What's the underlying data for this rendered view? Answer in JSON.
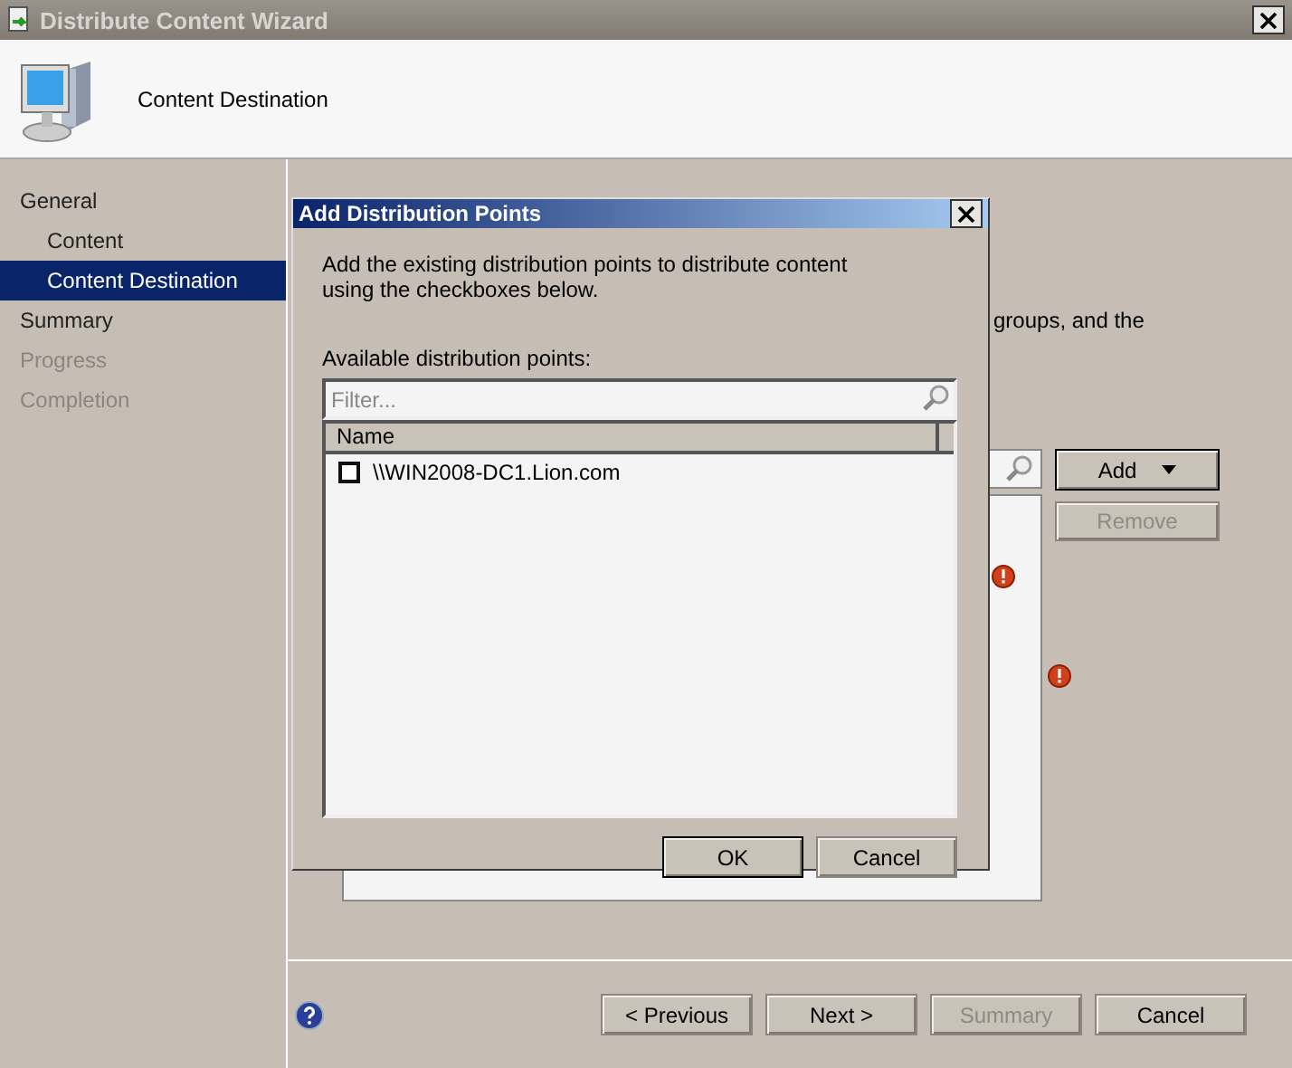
{
  "window": {
    "title": "Distribute Content Wizard"
  },
  "header": {
    "title": "Content Destination"
  },
  "nav": [
    {
      "label": "General",
      "selected": false,
      "disabled": false,
      "children": [
        {
          "label": "Content",
          "selected": false,
          "disabled": false
        },
        {
          "label": "Content Destination",
          "selected": true,
          "disabled": false
        }
      ]
    },
    {
      "label": "Summary",
      "selected": false,
      "disabled": false
    },
    {
      "label": "Progress",
      "selected": false,
      "disabled": true
    },
    {
      "label": "Completion",
      "selected": false,
      "disabled": true
    }
  ],
  "page": {
    "partial_text": "groups, and the",
    "add_button": "Add",
    "remove_button": {
      "label": "Remove",
      "disabled": true
    }
  },
  "footer": {
    "buttons": [
      {
        "label": "< Previous",
        "disabled": false
      },
      {
        "label": "Next >",
        "disabled": false
      },
      {
        "label": "Summary",
        "disabled": true
      },
      {
        "label": "Cancel",
        "disabled": false
      }
    ]
  },
  "dialog": {
    "title": "Add Distribution Points",
    "description": "Add the existing distribution points to distribute content using the checkboxes below.",
    "list_label": "Available distribution points:",
    "filter": {
      "placeholder": "Filter..."
    },
    "columns": [
      "Name"
    ],
    "rows": [
      {
        "name": "\\\\WIN2008-DC1.Lion.com",
        "checked": false
      }
    ],
    "buttons": [
      {
        "label": "OK",
        "default": true
      },
      {
        "label": "Cancel",
        "default": false
      }
    ]
  }
}
